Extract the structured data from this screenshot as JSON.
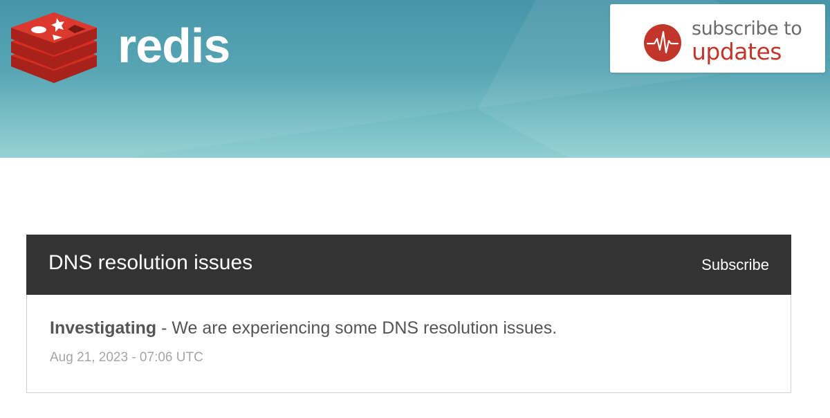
{
  "header": {
    "brand": "redis",
    "subscribe_box": {
      "line1": "subscribe to",
      "line2": "updates"
    },
    "colors": {
      "brand_red": "#d82c20",
      "accent_red": "#c2352a"
    }
  },
  "incident": {
    "title": "DNS resolution issues",
    "subscribe_label": "Subscribe",
    "update": {
      "status": "Investigating",
      "separator": " - ",
      "message": "We are experiencing some DNS resolution issues.",
      "timestamp": "Aug 21, 2023 - 07:06 UTC"
    }
  },
  "icons": [
    "redis-logo-icon",
    "pulse-icon"
  ]
}
